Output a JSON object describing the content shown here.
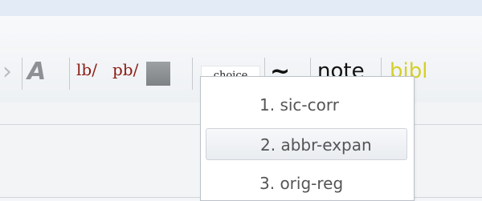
{
  "toolbar": {
    "lb_label": "lb/",
    "pb_label": "pb/",
    "choice_label": "choice",
    "tilde_label": "~",
    "note_label": "note",
    "bibl_label": "bibl"
  },
  "menu": {
    "items": [
      {
        "label": "1. sic-corr"
      },
      {
        "label": "2. abbr-expan"
      },
      {
        "label": "3. orig-reg"
      }
    ]
  },
  "colors": {
    "tag_red": "#8b1c12",
    "bibl_yellow": "#d4cf29",
    "menu_text": "#555555"
  }
}
